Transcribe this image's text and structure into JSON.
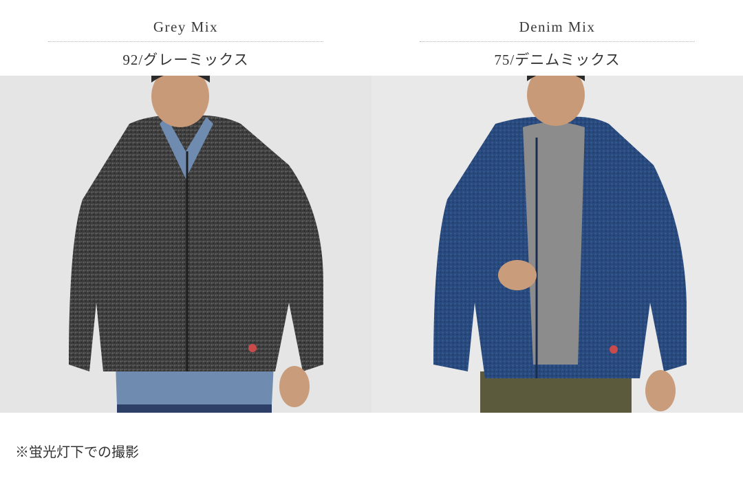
{
  "variants": [
    {
      "name": "Grey Mix",
      "code": "92/グレーミックス",
      "colors": {
        "jacket": "#3a3a3a",
        "shirt": "#6f8bb0",
        "backdrop": "#e6e6e6"
      }
    },
    {
      "name": "Denim Mix",
      "code": "75/デニムミックス",
      "colors": {
        "jacket": "#27477a",
        "sweater": "#8c8c8c",
        "pants": "#5b5a3c",
        "backdrop": "#e9e9e9"
      }
    }
  ],
  "note": "※蛍光灯下での撮影"
}
